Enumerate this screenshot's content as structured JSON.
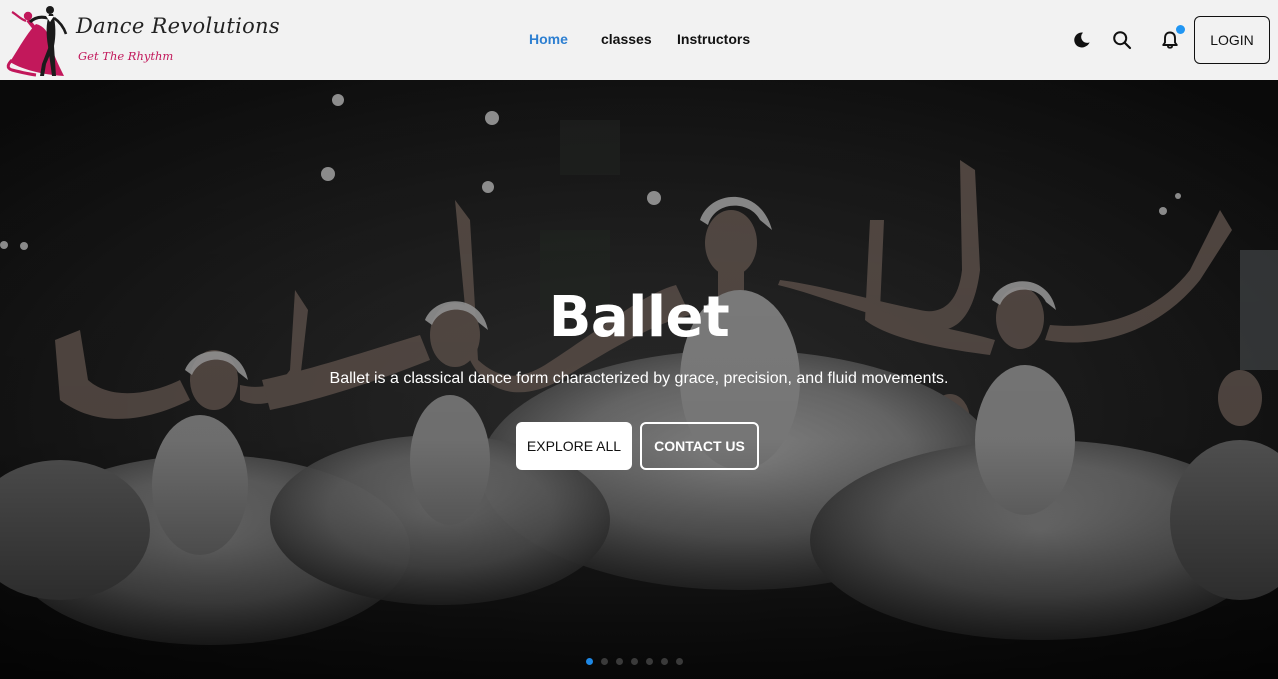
{
  "brand": {
    "title": "Dance Revolutions",
    "tagline": "Get The Rhythm",
    "accent_color": "#c2185b"
  },
  "nav": {
    "links": [
      {
        "label": "Home",
        "active": true
      },
      {
        "label": "classes",
        "active": false
      },
      {
        "label": "Instructors",
        "active": false
      }
    ],
    "icons": [
      "moon-icon",
      "search-icon",
      "bell-icon"
    ],
    "notification_dot_color": "#2196f3",
    "login_label": "LOGIN",
    "active_color": "#2d7fd1"
  },
  "hero": {
    "title": "Ballet",
    "description": "Ballet is a classical dance form characterized by grace, precision, and fluid movements.",
    "primary_button": "EXPLORE ALL",
    "secondary_button": "CONTACT US",
    "slide_count": 7,
    "active_slide": 1
  }
}
